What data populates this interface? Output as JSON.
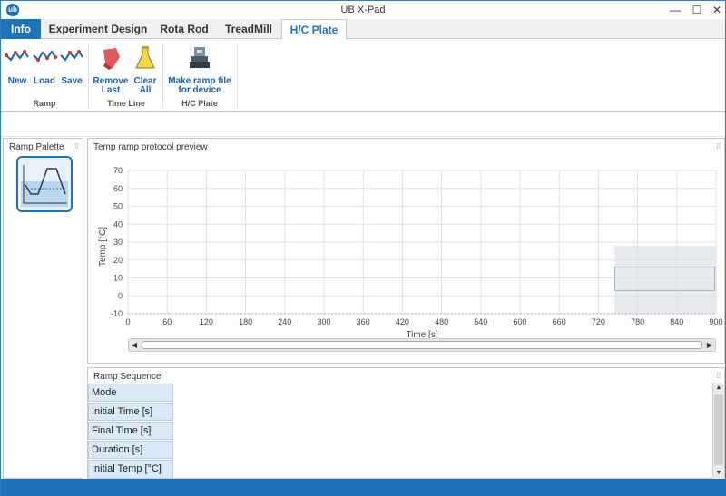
{
  "window": {
    "title": "UB X-Pad",
    "logo_text": "ub",
    "minimize": "—",
    "maximize": "☐",
    "close": "✕"
  },
  "tabs": [
    {
      "label": "Info"
    },
    {
      "label": "Experiment Design"
    },
    {
      "label": "Rota Rod"
    },
    {
      "label": "TreadMill"
    },
    {
      "label": "H/C Plate"
    }
  ],
  "ribbon": {
    "ramp_group": {
      "label": "Ramp",
      "new": "New",
      "load": "Load",
      "save": "Save"
    },
    "timeline_group": {
      "label": "Time Line",
      "remove_last_1": "Remove",
      "remove_last_2": "Last",
      "clear_all_1": "Clear",
      "clear_all_2": "All"
    },
    "hcplate_group": {
      "label": "H/C Plate",
      "make_ramp_1": "Make ramp file",
      "make_ramp_2": "for device"
    }
  },
  "palette": {
    "title": "Ramp Palette"
  },
  "preview": {
    "title": "Temp ramp protocol preview"
  },
  "chart_data": {
    "type": "line",
    "xlabel": "Time [s]",
    "ylabel": "Temp [°C]",
    "xlim": [
      0,
      900
    ],
    "ylim": [
      -10,
      70
    ],
    "x_ticks": [
      0,
      60,
      120,
      180,
      240,
      300,
      360,
      420,
      480,
      540,
      600,
      660,
      720,
      780,
      840,
      900
    ],
    "y_ticks": [
      -10,
      0,
      10,
      20,
      30,
      40,
      50,
      60,
      70
    ],
    "grid": true,
    "series": [],
    "selection_region": {
      "x": [
        745,
        900
      ],
      "y": [
        -10,
        28
      ]
    },
    "inner_box": {
      "x": [
        745,
        898
      ],
      "y": [
        3,
        16
      ]
    }
  },
  "sequence": {
    "title": "Ramp Sequence",
    "rows": [
      "Mode",
      "Initial Time [s]",
      "Final Time [s]",
      "Duration [s]",
      "Initial Temp [°C]"
    ]
  },
  "colors": {
    "accent": "#1f73bd",
    "header_cell": "#dbe8f6"
  }
}
